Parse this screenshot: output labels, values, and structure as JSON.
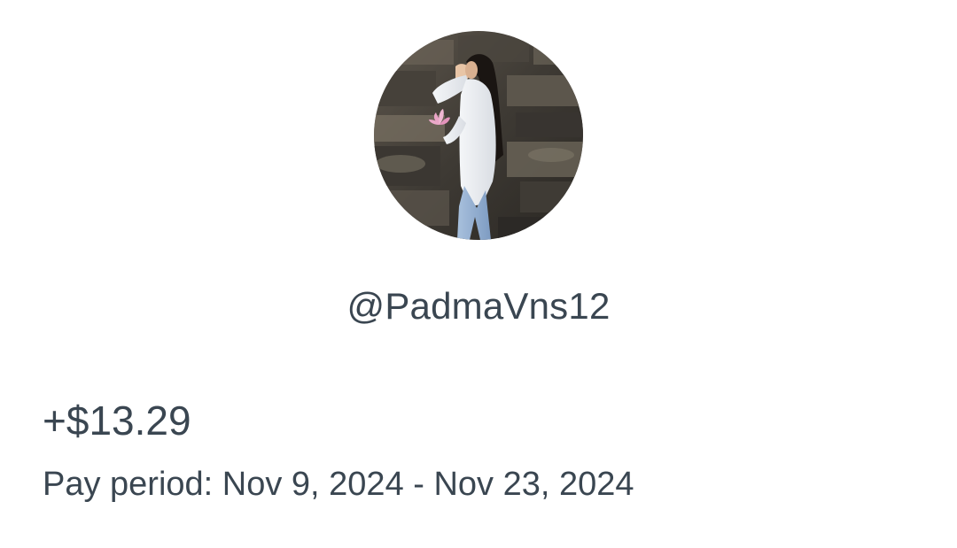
{
  "profile": {
    "avatar_icon": "profile-photo",
    "handle": "@PadmaVns12"
  },
  "payout": {
    "amount": "+$13.29",
    "period": "Pay period: Nov 9, 2024 - Nov 23, 2024"
  },
  "colors": {
    "text": "#3a4651",
    "background": "#ffffff"
  }
}
